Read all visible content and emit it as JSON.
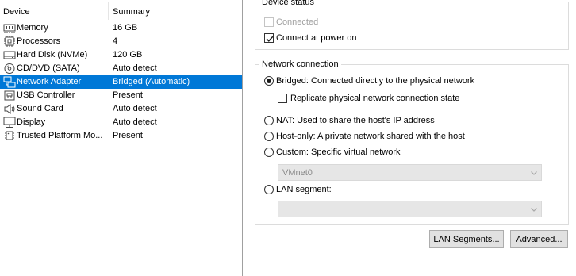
{
  "device_list": {
    "columns": {
      "device": "Device",
      "summary": "Summary"
    },
    "rows": [
      {
        "name": "Memory",
        "summary": "16 GB",
        "icon": "memory-icon"
      },
      {
        "name": "Processors",
        "summary": "4",
        "icon": "processor-icon"
      },
      {
        "name": "Hard Disk (NVMe)",
        "summary": "120 GB",
        "icon": "hard-disk-icon"
      },
      {
        "name": "CD/DVD (SATA)",
        "summary": "Auto detect",
        "icon": "cd-dvd-icon"
      },
      {
        "name": "Network Adapter",
        "summary": "Bridged (Automatic)",
        "icon": "network-adapter-icon",
        "selected": true
      },
      {
        "name": "USB Controller",
        "summary": "Present",
        "icon": "usb-icon"
      },
      {
        "name": "Sound Card",
        "summary": "Auto detect",
        "icon": "speaker-icon"
      },
      {
        "name": "Display",
        "summary": "Auto detect",
        "icon": "monitor-icon"
      },
      {
        "name": "Trusted Platform Mo...",
        "summary": "Present",
        "icon": "tpm-chip-icon"
      }
    ],
    "selection_color": "#0078d7"
  },
  "device_status": {
    "legend": "Device status",
    "connected": {
      "label": "Connected",
      "checked": false,
      "enabled": false
    },
    "connect_at_power_on": {
      "label": "Connect at power on",
      "checked": true,
      "enabled": true
    }
  },
  "network_connection": {
    "legend": "Network connection",
    "bridged": {
      "label": "Bridged: Connected directly to the physical network",
      "selected": true
    },
    "replicate": {
      "label": "Replicate physical network connection state",
      "checked": false
    },
    "nat": {
      "label": "NAT: Used to share the host's IP address",
      "selected": false
    },
    "host_only": {
      "label": "Host-only: A private network shared with the host",
      "selected": false
    },
    "custom": {
      "label": "Custom: Specific virtual network",
      "selected": false
    },
    "custom_network_value": "VMnet0",
    "lan_segment": {
      "label": "LAN segment:",
      "selected": false
    },
    "lan_segment_value": ""
  },
  "buttons": {
    "lan_segments": "LAN Segments...",
    "advanced": "Advanced..."
  }
}
